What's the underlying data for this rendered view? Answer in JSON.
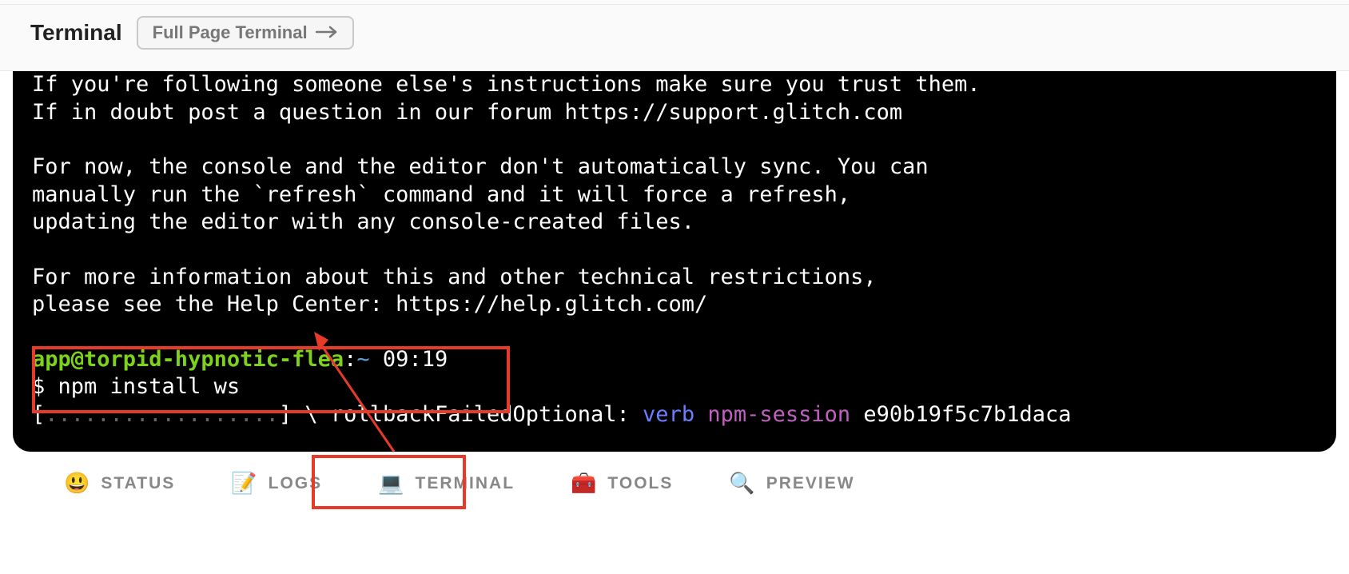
{
  "header": {
    "title": "Terminal",
    "full_page_label": "Full Page Terminal"
  },
  "terminal": {
    "lines": [
      "If you're following someone else's instructions make sure you trust them.",
      "If in doubt post a question in our forum https://support.glitch.com",
      "",
      "For now, the console and the editor don't automatically sync. You can",
      "manually run the `refresh` command and it will force a refresh,",
      "updating the editor with any console-created files.",
      "",
      "For more information about this and other technical restrictions,",
      "please see the Help Center: https://help.glitch.com/"
    ],
    "prompt": {
      "host": "app@torpid-hypnotic-flea",
      "colon": ":",
      "tilde": "~",
      "time": " 09:19",
      "dollar_line": "$ ",
      "command": "npm install ws"
    },
    "npm": {
      "open": "[",
      "dots": "..................",
      "close": "]",
      "slash": " \\ ",
      "stage": "rollbackFailedOptional:",
      "verb": " verb ",
      "session_label": "npm-session",
      "session_id": " e90b19f5c7b1daca"
    }
  },
  "footer": {
    "items": [
      {
        "emoji": "😃",
        "label": "STATUS"
      },
      {
        "emoji": "📝",
        "label": "LOGS"
      },
      {
        "emoji": "💻",
        "label": "TERMINAL"
      },
      {
        "emoji": "🧰",
        "label": "TOOLS"
      },
      {
        "emoji": "🔍",
        "label": "PREVIEW"
      }
    ]
  }
}
